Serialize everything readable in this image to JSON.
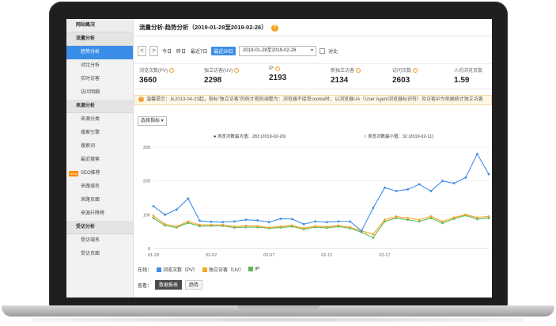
{
  "sidebar": {
    "overview": "网站概况",
    "groups": [
      {
        "title": "流量分析",
        "items": [
          "趋势分析",
          "对比分析",
          "实时访客",
          "访问明细"
        ]
      },
      {
        "title": "来源分析",
        "items": [
          "来源分类",
          "搜索引擎",
          "搜索词",
          "最近搜索",
          "SEO推荐",
          "来路域名",
          "来路页面",
          "来源升降榜"
        ]
      },
      {
        "title": "受访分析",
        "items": [
          "受访域名",
          "受访页面"
        ]
      }
    ],
    "active_item": "趋势分析",
    "new_badge": "NEW"
  },
  "header": {
    "title": "流量分析-趋势分析（2019-01-28至2019-02-26）",
    "help_icon": "?"
  },
  "date_bar": {
    "prev": "<",
    "next": ">",
    "quick_links": [
      "今日",
      "昨日",
      "最近7日",
      "最近30日"
    ],
    "active_quick": "最近30日",
    "date_range": "2019-01-28至2019-02-26",
    "compare_label": "对比"
  },
  "metrics": [
    {
      "label": "浏览次数(PV)",
      "value": "3660"
    },
    {
      "label": "独立访客(UV)",
      "value": "2298"
    },
    {
      "label": "IP",
      "value": "2193"
    },
    {
      "label": "新独立访客",
      "value": "2134"
    },
    {
      "label": "访问次数",
      "value": "2603"
    },
    {
      "label": "人均浏览页数",
      "value": "1.59"
    }
  ],
  "notice": "温馨提示：从2013-04-23起，指标“独立访客”的统计规则调整为：浏览器不接受cookie时，以浏览器UA（User Agent浏览器标识符）及访客IP为依据统计独立访客",
  "metric_select": "选择指标 ▾",
  "chart_data": {
    "type": "line",
    "annotation_max": "浏览次数最大值：283 (2019-02-20)",
    "annotation_min": "浏览次数最小值：32 (2019-02-11)",
    "ylim": [
      0,
      300
    ],
    "yticks": [
      0,
      100,
      200,
      300
    ],
    "x": [
      "01-28",
      "01-29",
      "01-30",
      "01-31",
      "02-01",
      "02-02",
      "02-03",
      "02-04",
      "02-05",
      "02-06",
      "02-07",
      "02-08",
      "02-09",
      "02-10",
      "02-11",
      "02-12",
      "02-13",
      "02-14",
      "02-15",
      "02-16",
      "02-17",
      "02-18",
      "02-19",
      "02-20",
      "02-21",
      "02-22",
      "02-23",
      "02-24",
      "02-25",
      "02-26"
    ],
    "xtick_labels": [
      "01-28",
      "02-02",
      "02-07",
      "02-12",
      "02-17"
    ],
    "xtick_index": [
      0,
      5,
      10,
      15,
      20
    ],
    "series": [
      {
        "name": "浏览次数（PV）",
        "color": "#3b8ee8",
        "values": [
          125,
          100,
          115,
          148,
          82,
          79,
          78,
          80,
          85,
          83,
          78,
          88,
          87,
          72,
          80,
          78,
          80,
          80,
          52,
          120,
          180,
          170,
          175,
          190,
          170,
          200,
          193,
          210,
          280,
          220
        ]
      },
      {
        "name": "独立访客（UV）",
        "color": "#f5a623",
        "values": [
          97,
          72,
          65,
          80,
          70,
          70,
          70,
          65,
          67,
          66,
          62,
          65,
          68,
          60,
          66,
          64,
          68,
          63,
          52,
          42,
          85,
          95,
          90,
          85,
          95,
          80,
          92,
          100,
          92,
          95
        ]
      },
      {
        "name": "IP",
        "color": "#5cb85c",
        "values": [
          90,
          68,
          62,
          76,
          66,
          67,
          67,
          62,
          63,
          63,
          60,
          62,
          65,
          57,
          63,
          61,
          65,
          60,
          48,
          32,
          80,
          90,
          85,
          80,
          90,
          75,
          88,
          98,
          87,
          90
        ]
      }
    ],
    "legend_prefix": "在线："
  },
  "bottom_tabs": {
    "prefix": "查看：",
    "tabs": [
      "数据报表",
      "趋势"
    ],
    "active": "数据报表"
  }
}
